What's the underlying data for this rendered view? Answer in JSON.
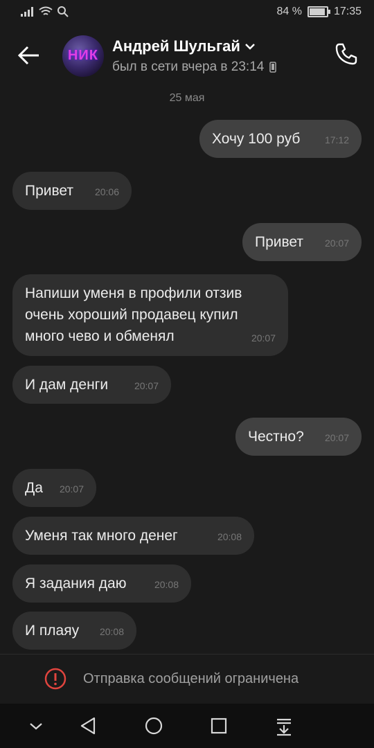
{
  "status_bar": {
    "battery": "84 %",
    "time": "17:35"
  },
  "header": {
    "contact_name": "Андрей Шульгай",
    "last_seen": "был в сети вчера в 23:14",
    "avatar_text": "НИК"
  },
  "chat": {
    "date_separator": "25 мая",
    "messages": [
      {
        "text": "Хочу 100 руб",
        "time": "17:12",
        "direction": "out"
      },
      {
        "text": "Привет",
        "time": "20:06",
        "direction": "in"
      },
      {
        "text": "Привет",
        "time": "20:07",
        "direction": "out"
      },
      {
        "text": "Напиши уменя в профили отзив очень хороший продавец купил много чево и обменял",
        "time": "20:07",
        "direction": "in"
      },
      {
        "text": "И дам денги",
        "time": "20:07",
        "direction": "in"
      },
      {
        "text": "Честно?",
        "time": "20:07",
        "direction": "out"
      },
      {
        "text": "Да",
        "time": "20:07",
        "direction": "in"
      },
      {
        "text": "Уменя так много денег",
        "time": "20:08",
        "direction": "in"
      },
      {
        "text": "Я задания даю",
        "time": "20:08",
        "direction": "in"
      },
      {
        "text": "И плаяу",
        "time": "20:08",
        "direction": "in"
      }
    ]
  },
  "footer": {
    "restriction_text": "Отправка сообщений ограничена"
  }
}
